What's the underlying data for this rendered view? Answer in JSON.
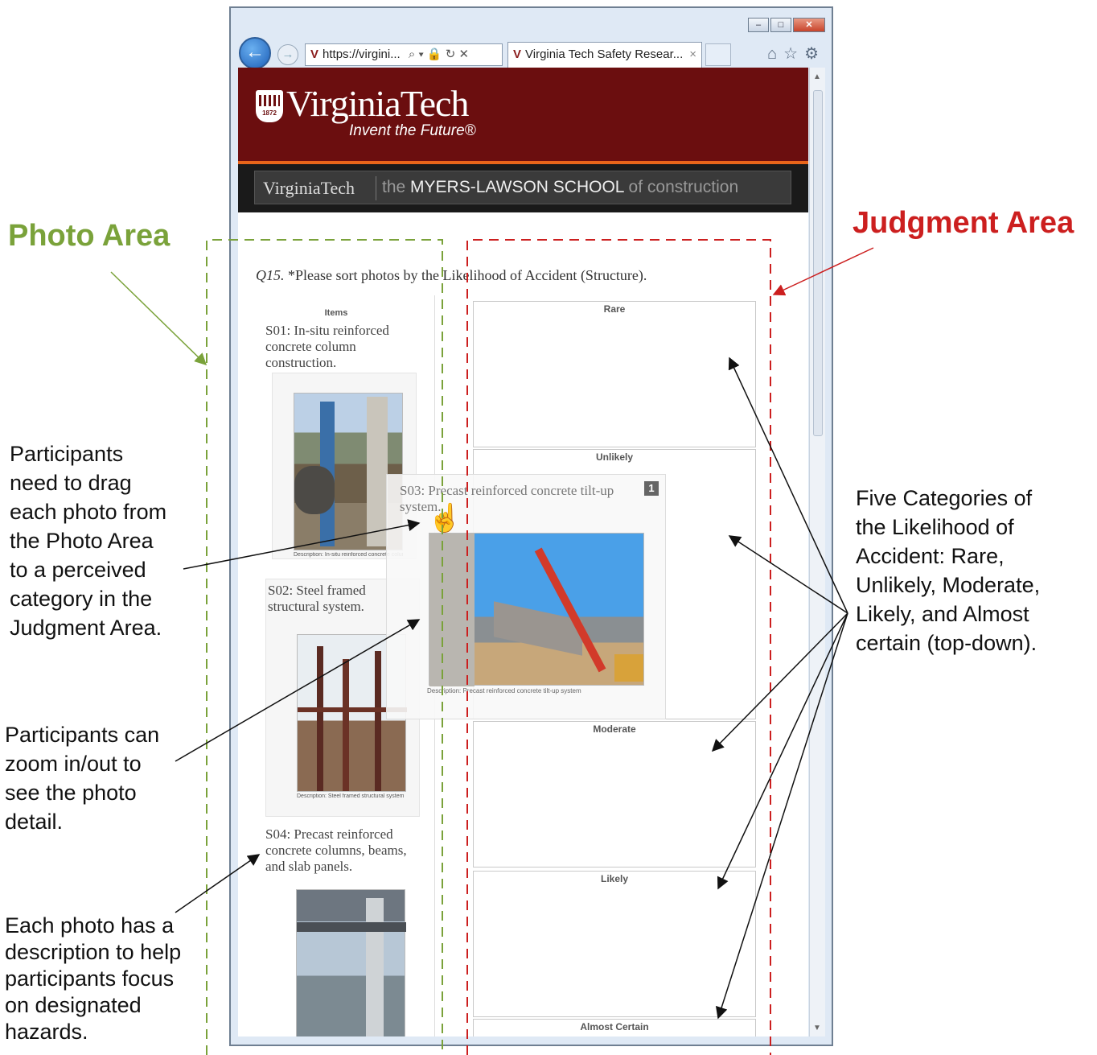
{
  "browser": {
    "address": "https://virgini...",
    "address_tools": "⌕ ▾ 🔒 ↻ ✕",
    "tab_title": "Virginia Tech Safety Resear...",
    "tab_close": "×",
    "window_buttons": [
      "–",
      "□",
      "✕"
    ],
    "toolbar_icons": [
      "home-icon",
      "star-icon",
      "gear-icon"
    ]
  },
  "page": {
    "logo_text": "VirginiaTech",
    "tagline": "Invent the Future®",
    "shield_year": "1872",
    "band_logo": "VirginiaTech",
    "school_prefix": "the",
    "school_name": "MYERS-LAWSON SCHOOL",
    "school_suffix": "of construction",
    "question_number": "Q15.",
    "question_text": "*Please sort photos by the Likelihood of Accident  (Structure).",
    "items_header": "Items",
    "items": [
      {
        "label": "S01: In-situ reinforced concrete column construction.",
        "caption": "Description: In-situ reinforced concrete column construction"
      },
      {
        "label": "S02: Steel framed structural system.",
        "caption": "Description: Steel framed structural system"
      },
      {
        "label": "S04: Precast reinforced concrete columns, beams, and slab panels.",
        "caption": ""
      }
    ],
    "dragged_item": {
      "label": "S03: Precast reinforced concrete tilt-up system.",
      "badge": "1",
      "caption": "Description: Precast reinforced concrete tilt-up system"
    },
    "categories": [
      "Rare",
      "Unlikely",
      "Moderate",
      "Likely",
      "Almost Certain"
    ]
  },
  "annotations": {
    "photo_area": "Photo Area",
    "judgment_area": "Judgment Area",
    "drag_note": [
      "Participants",
      "need to drag",
      "each photo from",
      "the Photo Area",
      "to a perceived",
      "category in the",
      "Judgment Area."
    ],
    "zoom_note": [
      "Participants can",
      "zoom in/out to",
      "see the photo",
      "detail."
    ],
    "desc_note": [
      "Each photo has a",
      "description to help",
      "participants focus",
      "on designated",
      "hazards."
    ],
    "categories_note": [
      "Five Categories of",
      "the Likelihood of",
      "Accident: Rare,",
      "Unlikely, Moderate,",
      "Likely, and Almost",
      "certain (top-down)."
    ]
  },
  "colors": {
    "vt_maroon": "#6b0e0f",
    "vt_orange": "#e8651a",
    "photo_area": "#7aa23a",
    "judgment_area": "#cc1f1f"
  }
}
